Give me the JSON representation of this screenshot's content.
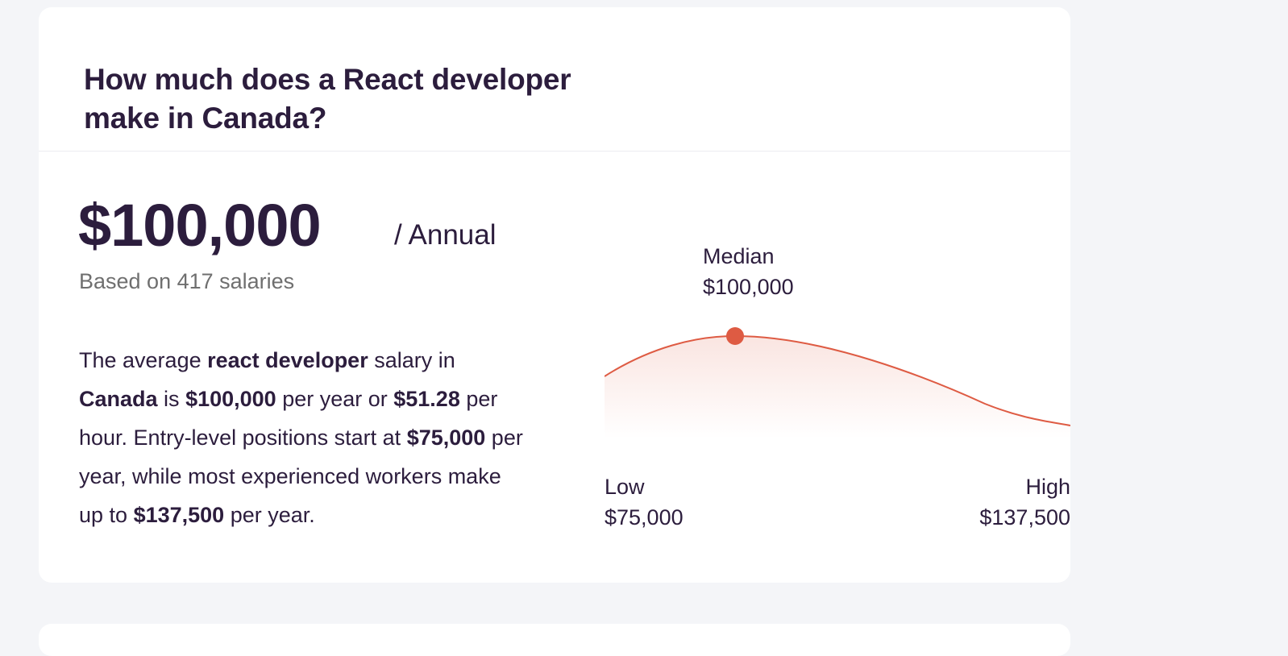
{
  "page": {
    "title": "How much does a React developer make in Canada?",
    "salary": {
      "amount": "$100,000",
      "period": "/ Annual",
      "basis": "Based on 417 salaries"
    },
    "description": {
      "t1": "The average ",
      "b1": "react developer",
      "t2": " salary in ",
      "b2": "Canada",
      "t3": " is ",
      "b3": "$100,000",
      "t4": " per year or ",
      "b4": "$51.28",
      "t5": " per hour. Entry-level positions start at ",
      "b5": "$75,000",
      "t6": " per year, while most experienced workers make up to ",
      "b6": "$137,500",
      "t7": " per year."
    }
  },
  "chart_data": {
    "type": "area",
    "low": {
      "label": "Low",
      "value_text": "$75,000",
      "value": 75000
    },
    "median": {
      "label": "Median",
      "value_text": "$100,000",
      "value": 100000
    },
    "high": {
      "label": "High",
      "value_text": "$137,500",
      "value": 137500
    },
    "line_color": "#de5b43",
    "marker_color": "#de5b43"
  },
  "colors": {
    "text": "#2c1d3d",
    "muted": "#6f6f6f",
    "background": "#f4f5f8",
    "card": "#ffffff"
  }
}
